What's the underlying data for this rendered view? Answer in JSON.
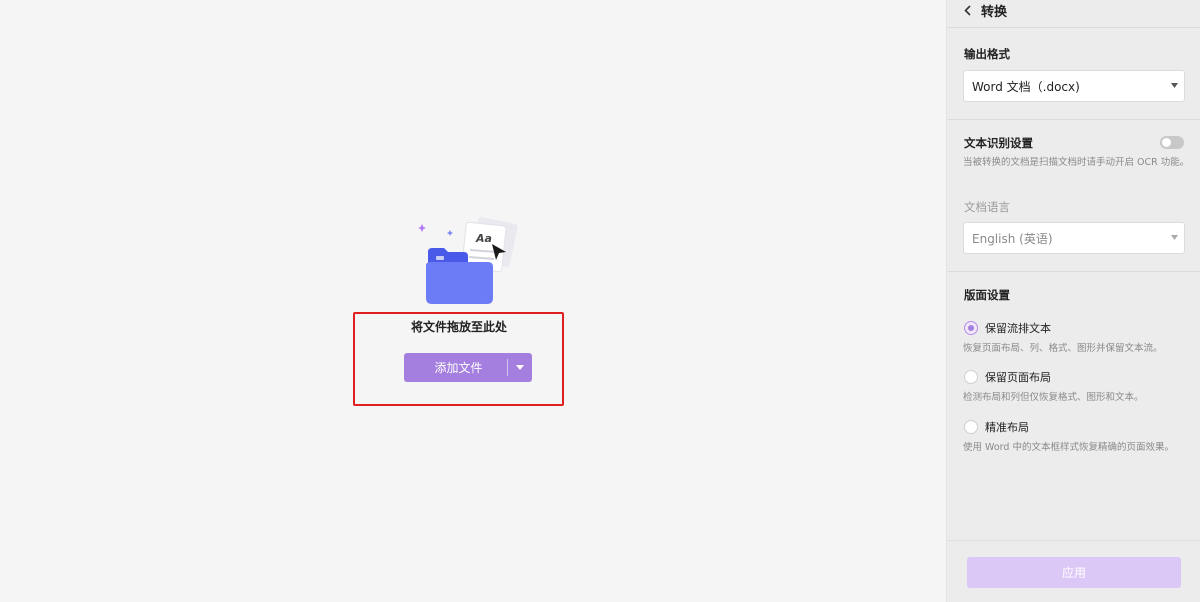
{
  "drop_area": {
    "title": "将文件拖放至此处",
    "add_button_label": "添加文件",
    "illustration_text": "Aa"
  },
  "panel": {
    "title": "转换",
    "output_format": {
      "label": "输出格式",
      "value": "Word 文档（.docx)"
    },
    "ocr": {
      "label": "文本识别设置",
      "enabled": false,
      "hint": "当被转换的文档是扫描文档时请手动开启 OCR 功能。"
    },
    "language": {
      "label": "文档语言",
      "value": "English (英语)"
    },
    "layout": {
      "label": "版面设置",
      "options": [
        {
          "label": "保留流排文本",
          "description": "恢复页面布局、列、格式、图形并保留文本流。",
          "selected": true
        },
        {
          "label": "保留页面布局",
          "description": "检测布局和列但仅恢复格式、图形和文本。",
          "selected": false
        },
        {
          "label": "精准布局",
          "description": "使用 Word 中的文本框样式恢复精确的页面效果。",
          "selected": false
        }
      ]
    },
    "apply_label": "应用"
  },
  "colors": {
    "accent": "#a57fdf",
    "accent_light": "#dcc8f7",
    "highlight_box": "#e02020",
    "folder_blue": "#5b6cf0"
  },
  "icons": [
    "folder-icon",
    "document-icon",
    "cursor-icon",
    "sparkle-icon",
    "chevron-down-icon",
    "back-chevron-icon"
  ]
}
